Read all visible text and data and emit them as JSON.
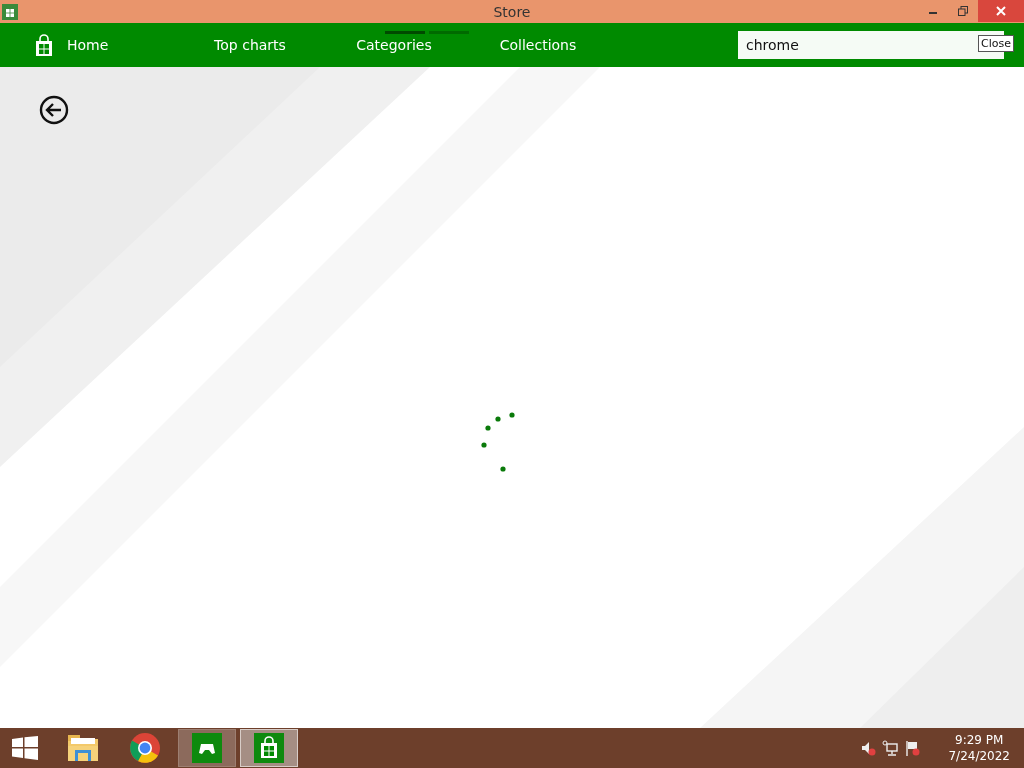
{
  "window": {
    "title": "Store"
  },
  "nav": {
    "items": [
      {
        "label": "Home",
        "kind": "home"
      },
      {
        "label": "Top charts",
        "kind": "link"
      },
      {
        "label": "Categories",
        "kind": "link"
      },
      {
        "label": "Collections",
        "kind": "link"
      }
    ]
  },
  "search": {
    "value": "chrome"
  },
  "tooltip": {
    "text": "Close"
  },
  "taskbar": {
    "items": [
      {
        "kind": "start",
        "running": false,
        "selected": false
      },
      {
        "kind": "explorer",
        "running": false,
        "selected": false
      },
      {
        "kind": "chrome",
        "running": false,
        "selected": false
      },
      {
        "kind": "games",
        "running": true,
        "selected": false
      },
      {
        "kind": "store",
        "running": true,
        "selected": true
      }
    ],
    "tray": [
      {
        "kind": "volume"
      },
      {
        "kind": "network"
      },
      {
        "kind": "flag"
      }
    ],
    "time": "9:29 PM",
    "date": "7/24/2022"
  }
}
